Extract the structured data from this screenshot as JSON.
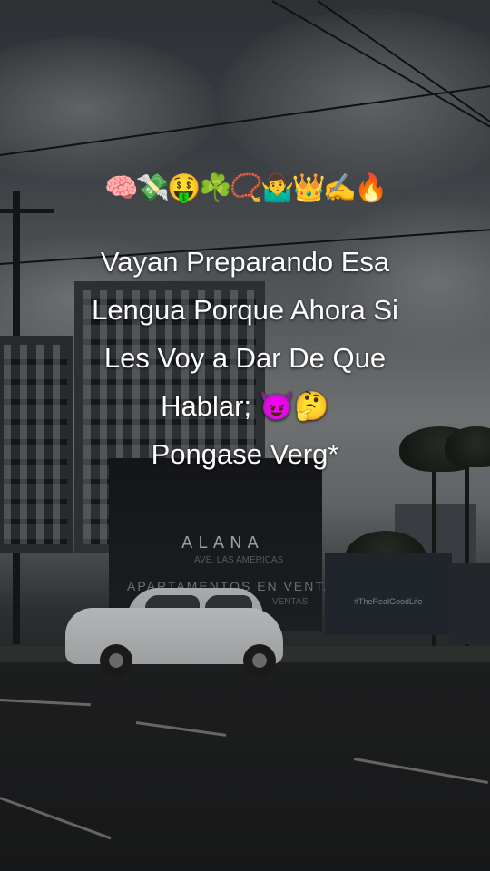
{
  "emoji_line": "🧠💸🤑☘️📿🤷‍♂️👑✍️🔥",
  "caption": {
    "line1": "Vayan Preparando Esa",
    "line2": "Lengua Porque Ahora Si",
    "line3": "Les Voy a Dar De Que",
    "line4": "Hablar; 😈🤔",
    "line5": "Pongase Verg*"
  },
  "signage": {
    "brand": "ALANA",
    "brand_sub": "AVE. LAS AMERICAS",
    "banner": "APARTAMENTOS EN VENTA",
    "banner_sub": "VENTAS",
    "hashtag": "#TheRealGoodLife"
  }
}
